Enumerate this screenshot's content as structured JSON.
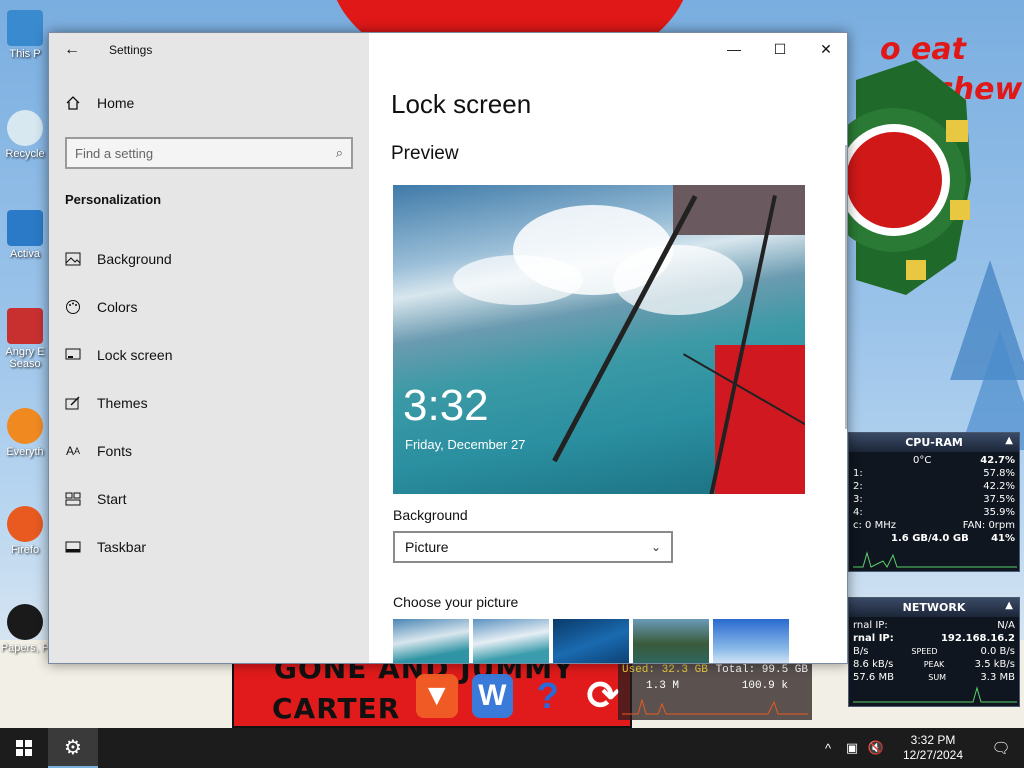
{
  "desktop": {
    "icons": [
      {
        "label": "This P"
      },
      {
        "label": "Recycle"
      },
      {
        "label": "Activa"
      },
      {
        "label": "Angry E Seaso"
      },
      {
        "label": "Everyth"
      },
      {
        "label": "Firefo"
      },
      {
        "label": "Papers, P"
      }
    ],
    "graffiti_line1": "o eat shi",
    "graffiti_line2": "chew",
    "banner_line1": "GONE AND JUMMY",
    "banner_line2": "CARTER"
  },
  "drive_widget": {
    "used": "Used: 32.3 GB",
    "total": "Total: 99.5 GB",
    "read": "1.3 M",
    "write": "100.9 k"
  },
  "cpu_ram": {
    "title": "CPU-RAM",
    "temp": "0°C",
    "cpu_total": "42.7%",
    "cores": [
      {
        "label": "1:",
        "value": "57.8%"
      },
      {
        "label": "2:",
        "value": "42.2%"
      },
      {
        "label": "3:",
        "value": "37.5%"
      },
      {
        "label": "4:",
        "value": "35.9%"
      }
    ],
    "clock": "c: 0 MHz",
    "fan": "FAN: 0rpm",
    "ram": "1.6 GB/4.0 GB",
    "ram_pct": "41%"
  },
  "network": {
    "title": "NETWORK",
    "ext_ip_label": "rnal IP:",
    "ext_ip": "N/A",
    "int_ip_label": "rnal IP:",
    "int_ip": "192.168.16.2",
    "row1_left": "B/s",
    "row1_mid": "SPEED",
    "row1_right": "0.0 B/s",
    "row2_left": "8.6 kB/s",
    "row2_mid": "PEAK",
    "row2_right": "3.5 kB/s",
    "row3_left": "57.6 MB",
    "row3_mid": "SUM",
    "row3_right": "3.3 MB"
  },
  "settings": {
    "app_title": "Settings",
    "home_label": "Home",
    "search_placeholder": "Find a setting",
    "section_title": "Personalization",
    "nav": [
      {
        "label": "Background",
        "icon": "picture-icon"
      },
      {
        "label": "Colors",
        "icon": "palette-icon"
      },
      {
        "label": "Lock screen",
        "icon": "lock-screen-icon"
      },
      {
        "label": "Themes",
        "icon": "themes-icon"
      },
      {
        "label": "Fonts",
        "icon": "fonts-icon"
      },
      {
        "label": "Start",
        "icon": "start-icon"
      },
      {
        "label": "Taskbar",
        "icon": "taskbar-icon"
      }
    ],
    "page_title": "Lock screen",
    "preview_heading": "Preview",
    "preview_time": "3:32",
    "preview_date": "Friday, December 27",
    "background_label": "Background",
    "background_value": "Picture",
    "choose_label": "Choose your picture"
  },
  "taskbar": {
    "time": "3:32 PM",
    "date": "12/27/2024"
  }
}
